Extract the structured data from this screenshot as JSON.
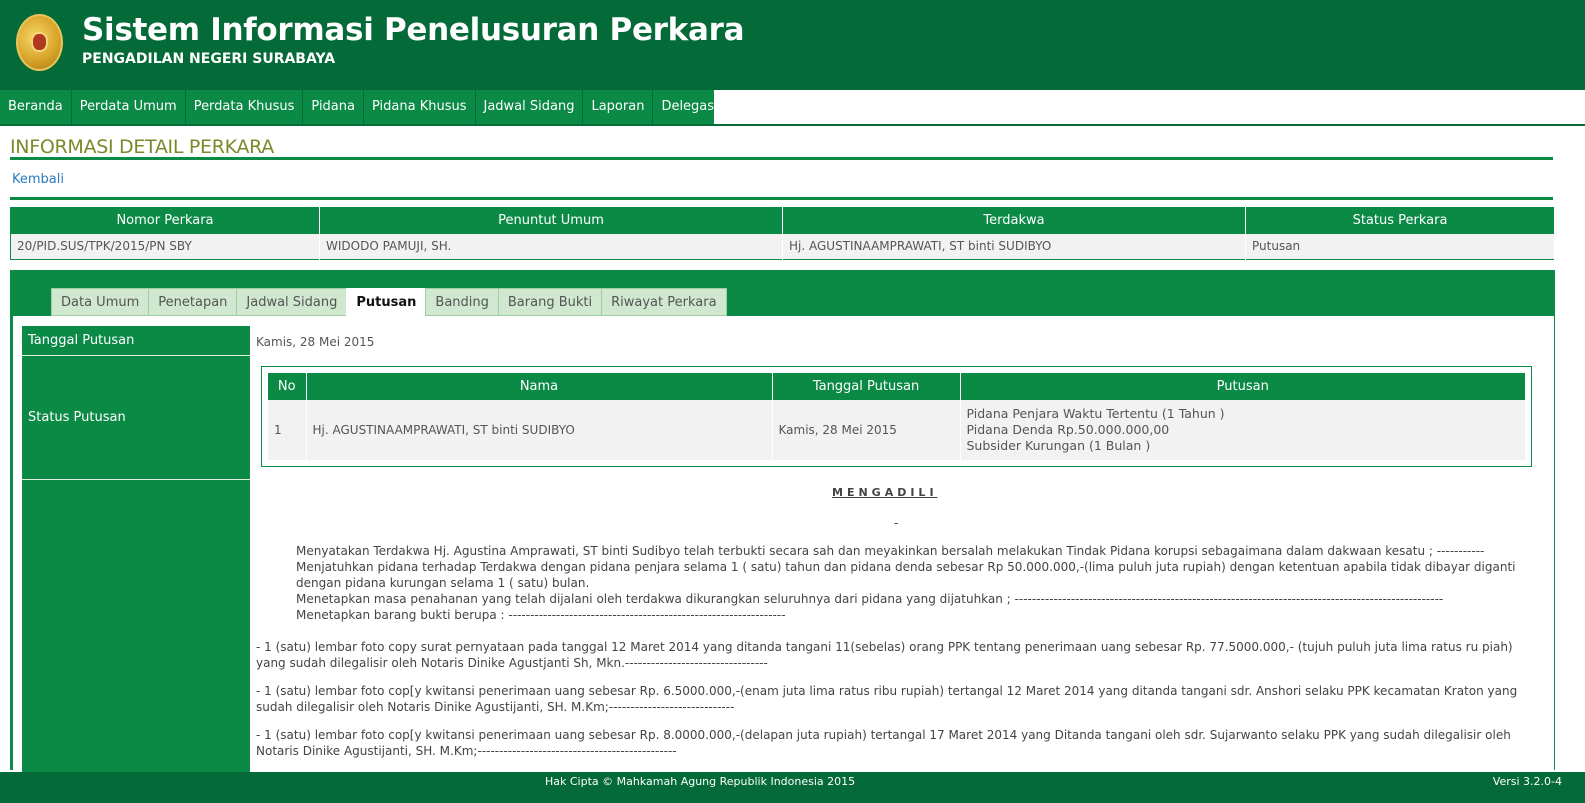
{
  "header": {
    "title": "Sistem Informasi Penelusuran Perkara",
    "subtitle": "PENGADILAN NEGERI SURABAYA",
    "logo_icon": "court-emblem-icon"
  },
  "nav": {
    "items": [
      "Beranda",
      "Perdata Umum",
      "Perdata Khusus",
      "Pidana",
      "Pidana Khusus",
      "Jadwal Sidang",
      "Laporan",
      "Delegasi"
    ]
  },
  "page": {
    "title": "INFORMASI DETAIL PERKARA",
    "back_link": "Kembali"
  },
  "summary": {
    "headers": [
      "Nomor Perkara",
      "Penuntut Umum",
      "Terdakwa",
      "Status Perkara"
    ],
    "row": [
      "20/PID.SUS/TPK/2015/PN SBY",
      "WIDODO PAMUJI, SH.",
      "Hj. AGUSTINAAMPRAWATI, ST binti SUDIBYO",
      "Putusan"
    ]
  },
  "tabs": {
    "items": [
      "Data Umum",
      "Penetapan",
      "Jadwal Sidang",
      "Putusan",
      "Banding",
      "Barang Bukti",
      "Riwayat Perkara"
    ],
    "active": "Putusan"
  },
  "detail": {
    "tanggal_label": "Tanggal Putusan",
    "tanggal_value": "Kamis, 28 Mei 2015",
    "status_label": "Status Putusan",
    "status_table": {
      "headers": [
        "No",
        "Nama",
        "Tanggal Putusan",
        "Putusan"
      ],
      "row": {
        "no": "1",
        "nama": "Hj. AGUSTINAAMPRAWATI, ST binti SUDIBYO",
        "tanggal": "Kamis, 28 Mei 2015",
        "putusan": [
          "Pidana Penjara Waktu Tertentu (1 Tahun )",
          "Pidana Denda Rp.50.000.000,00",
          "Subsider Kurungan (1 Bulan )"
        ]
      }
    },
    "mengadili": "MENGADILI",
    "dash": "-",
    "verdict_items": [
      "Menyatakan Terdakwa Hj. Agustina Amprawati, ST binti Sudibyo telah terbukti secara sah dan meyakinkan bersalah melakukan Tindak Pidana korupsi sebagaimana  dalam dakwaan kesatu  ; -----------",
      "Menjatuhkan pidana terhadap Terdakwa dengan pidana penjara selama 1 ( satu) tahun dan pidana denda sebesar Rp 50.000.000,-(lima puluh juta rupiah)  dengan ketentuan apabila tidak dibayar diganti dengan pidana kurungan  selama 1 ( satu)  bulan.",
      "Menetapkan masa penahanan  yang telah dijalani oleh terdakwa dikurangkan seluruhnya dari pidana yang dijatuhkan ; ---------------------------------------------------------------------------------------------------",
      "Menetapkan barang bukti berupa : ----------------------------------------------------------------"
    ],
    "evidence": [
      "-      1 (satu) lembar foto copy surat pernyataan pada tanggal 12 Maret 2014 yang ditanda tangani 11(sebelas) orang PPK tentang penerimaan uang sebesar Rp. 77.5000.000,- (tujuh puluh juta lima ratus ru piah) yang sudah dilegalisir oleh Notaris Dinike Agustjanti Sh, Mkn.---------------------------------",
      "-      1 (satu) lembar foto cop[y kwitansi penerimaan uang sebesar Rp. 6.5000.000,-(enam juta  lima ratus ribu rupiah) tertangal 12 Maret 2014 yang ditanda tangani sdr. Anshori selaku PPK kecamatan Kraton yang sudah dilegalisir oleh Notaris Dinike Agustijanti, SH. M.Km;-----------------------------",
      "-      1 (satu) lembar foto cop[y kwitansi penerimaan uang sebesar Rp. 8.0000.000,-(delapan juta rupiah) tertangal 17 Maret 2014 yang Ditanda tangani oleh sdr. Sujarwanto  selaku PPK yang sudah dilegalisir oleh Notaris Dinike Agustijanti, SH. M.Km;----------------------------------------------"
    ]
  },
  "footer": {
    "copyright": "Hak Cipta © Mahkamah Agung Republik Indonesia 2015",
    "version": "Versi 3.2.0-4"
  },
  "colors": {
    "primary_dark": "#046a38",
    "primary": "#0b8a46",
    "heading": "#7a8a2a",
    "link": "#2a7bbd"
  }
}
